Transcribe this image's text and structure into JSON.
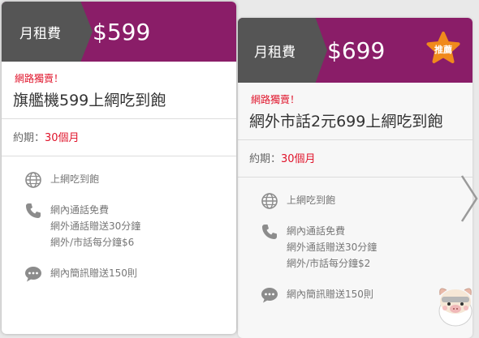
{
  "plans": [
    {
      "label": "月租費",
      "price": "$599",
      "promo": "網路獨賣！",
      "title": "旗艦機599上網吃到飽",
      "period_label": "約期：",
      "period_value": "30個月",
      "features": {
        "data": "上網吃到飽",
        "calls": [
          "網內通話免費",
          "網外通話贈送30分鐘",
          "網外/市話每分鐘$6"
        ],
        "sms": "網內簡訊贈送150則"
      }
    },
    {
      "label": "月租費",
      "price": "$699",
      "badge": "推薦",
      "promo": "網路獨賣！",
      "title": "網外市話2元699上網吃到飽",
      "period_label": "約期：",
      "period_value": "30個月",
      "features": {
        "data": "上網吃到飽",
        "calls": [
          "網內通話免費",
          "網外通話贈送30分鐘",
          "網外/市話每分鐘$2"
        ],
        "sms": "網內簡訊贈送150則"
      }
    }
  ],
  "icons": {
    "globe": "globe-icon",
    "phone": "phone-icon",
    "chat": "chat-bubble-icon",
    "next": "chevron-right-icon",
    "badge": "star-badge-icon"
  },
  "colors": {
    "header_bg": "#8a1d68",
    "label_bg": "#555555",
    "promo_red": "#e0142b",
    "badge_orange": "#f08a1c",
    "icon_gray": "#8c8c8c"
  }
}
